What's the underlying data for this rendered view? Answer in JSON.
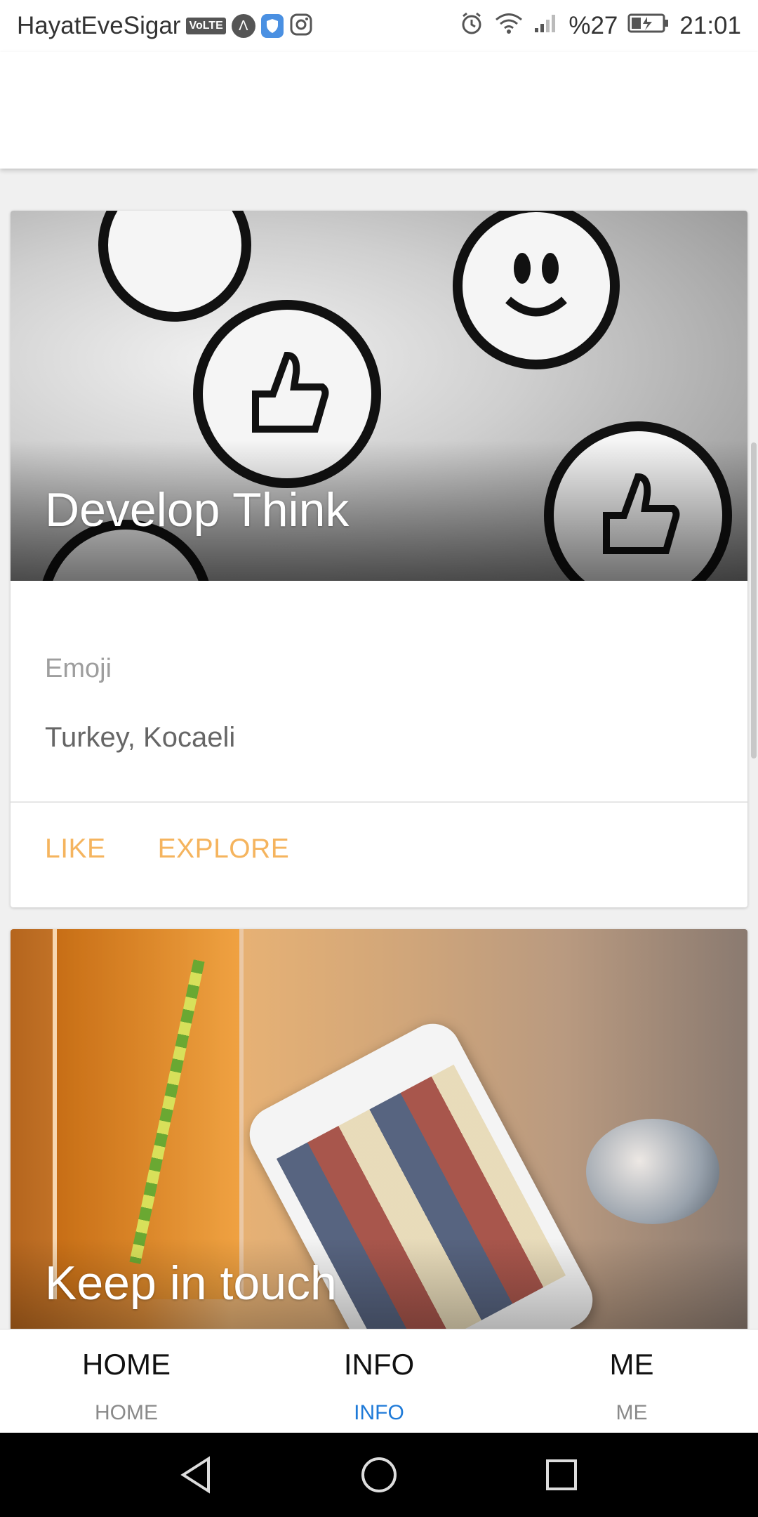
{
  "status_bar": {
    "carrier": "HayatEveSigar",
    "volte_badge": "VoLTE",
    "battery_percent": "%27",
    "time": "21:01"
  },
  "cards": [
    {
      "title": "Develop Think",
      "subtitle": "Emoji",
      "text": "Turkey, Kocaeli",
      "actions": [
        "LIKE",
        "EXPLORE"
      ]
    },
    {
      "title": "Keep in touch"
    }
  ],
  "bottom_nav": {
    "items": [
      {
        "icon_text": "HOME",
        "label": "HOME",
        "active": false
      },
      {
        "icon_text": "INFO",
        "label": "INFO",
        "active": true
      },
      {
        "icon_text": "ME",
        "label": "ME",
        "active": false
      }
    ],
    "active_color": "#1e7ad8"
  },
  "colors": {
    "accent_action": "#f5b45e",
    "active_tab": "#1e7ad8"
  }
}
